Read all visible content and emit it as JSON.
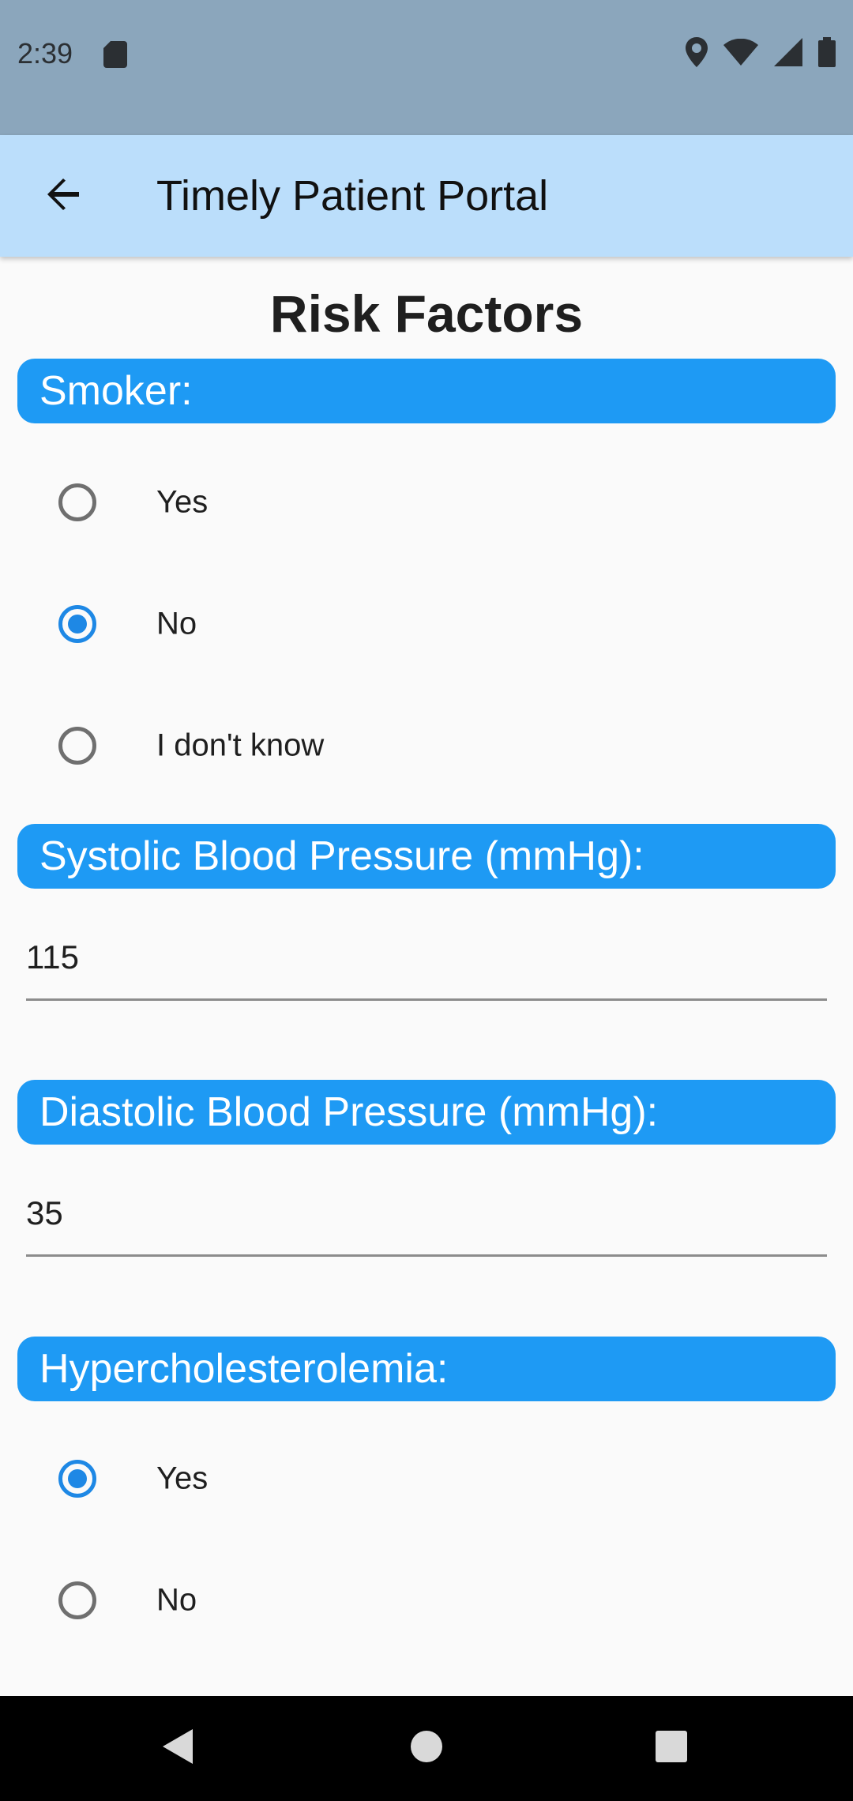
{
  "status_bar": {
    "time": "2:39",
    "icons": [
      "sd-card-icon",
      "location-icon",
      "wifi-icon",
      "cell-signal-icon",
      "battery-icon"
    ]
  },
  "app_bar": {
    "title": "Timely Patient Portal",
    "back_icon": "arrow-back-icon"
  },
  "page": {
    "title": "Risk Factors"
  },
  "smoker": {
    "header": "Smoker:",
    "options": [
      {
        "label": "Yes",
        "selected": false
      },
      {
        "label": "No",
        "selected": true
      },
      {
        "label": "I don't know",
        "selected": false
      }
    ]
  },
  "systolic": {
    "header": "Systolic Blood Pressure (mmHg):",
    "value": "115"
  },
  "diastolic": {
    "header": "Diastolic Blood Pressure (mmHg):",
    "value": "35"
  },
  "hypercholesterolemia": {
    "header": "Hypercholesterolemia:",
    "options": [
      {
        "label": "Yes",
        "selected": true
      },
      {
        "label": "No",
        "selected": false
      }
    ]
  },
  "nav_bar": {
    "icons": [
      "back-triangle-icon",
      "home-circle-icon",
      "recents-square-icon"
    ]
  },
  "colors": {
    "status_bar": "#8ba6bc",
    "app_bar": "#bbdefb",
    "section_header": "#1e9af4",
    "radio_selected": "#1e88e5",
    "background": "#fafafa"
  }
}
